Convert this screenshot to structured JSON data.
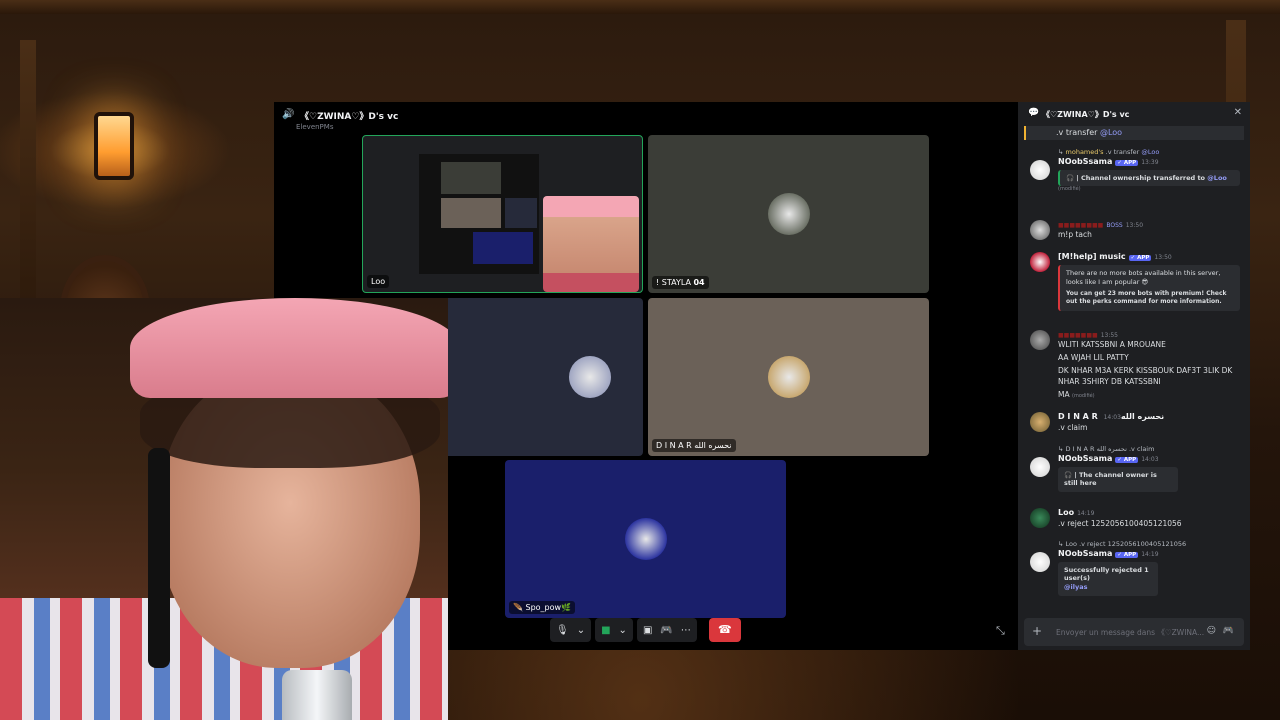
{
  "voice_channel": {
    "title": "《♡ZWINA♡》D's vc",
    "subtitle": "ElevenPMs"
  },
  "tiles": [
    {
      "name": "Loo",
      "kind": "screenshare",
      "bg": "#1e1f22",
      "avatar_color": ""
    },
    {
      "name": "! STAYLA 𝟬𝟰",
      "kind": "avatar",
      "bg": "#3b3d37",
      "avatar_color": "#6b7065"
    },
    {
      "name": "",
      "kind": "avatar",
      "bg": "#262a3a",
      "avatar_color": "#a0a6c2"
    },
    {
      "name": "D I N A R نحسره الله",
      "kind": "avatar",
      "bg": "#6b6158",
      "avatar_color": "#c8a870"
    },
    {
      "name": "🪶 Spo_pow🌿",
      "kind": "avatar",
      "bg": "#1a1f6b",
      "avatar_color": "#2c34a0"
    }
  ],
  "controls": {
    "mic_icon": "microphone-icon",
    "camera_icon": "camera-icon",
    "share_icon": "screenshare-icon",
    "activity_icon": "gamepad-icon",
    "more_icon": "more-icon",
    "end_icon": "phone-hangup-icon",
    "end_color": "#da373c"
  },
  "chat": {
    "title": "《♡ZWINA♡》D's vc",
    "pinned_text": ".v transfer ",
    "pinned_mention": "@Loo",
    "input_placeholder": "Envoyer un message dans 《♡ZWINA...",
    "messages": [
      {
        "reply_user": "mohamed's",
        "reply_text": ".v transfer",
        "reply_mention": "@Loo",
        "user": "NOobSsama",
        "badge": "✓ APP",
        "time": "13:39",
        "embed": "🎧 | Channel ownership transferred to",
        "embed_mention": "@Loo",
        "edited": "(modifié)"
      },
      {
        "user": "BOSS",
        "time": "13:50",
        "text": "m!p tach"
      },
      {
        "user": "[M!help] music",
        "badge": "✓ APP",
        "time": "13:50",
        "embed_line1": "There are no more bots available in this server, looks like I am popular 😎",
        "embed_line2": "You can get 23 more bots with premium! Check out the perks command for more information."
      },
      {
        "user": "",
        "time": "13:55",
        "lines": [
          "WLITI KATSSBNI A MROUANE",
          "AA WJAH LIL PATTY",
          "DK NHAR M3A KERK KISSBOUK DAF3T 3LIK DK NHAR 3SHIRY DB KATSSBNI",
          "MA"
        ],
        "edited": "(modifié)"
      },
      {
        "user": "D I N A R نحسره الله",
        "time": "14:03",
        "text": ".v claim"
      },
      {
        "reply_user": "D I N A R نحسره الله",
        "reply_text": ".v claim",
        "user": "NOobSsama",
        "badge": "✓ APP",
        "time": "14:03",
        "embed": "🎧 | The channel owner is still here"
      },
      {
        "user": "Loo",
        "time": "14:19",
        "text": ".v  reject 1252056100405121056"
      },
      {
        "reply_user": "Loo",
        "reply_text": ".v  reject 1252056100405121056",
        "user": "NOobSsama",
        "badge": "✓ APP",
        "time": "14:19",
        "embed": "Successfully rejected 1 user(s)",
        "embed_mention": "@ilyas"
      }
    ]
  }
}
